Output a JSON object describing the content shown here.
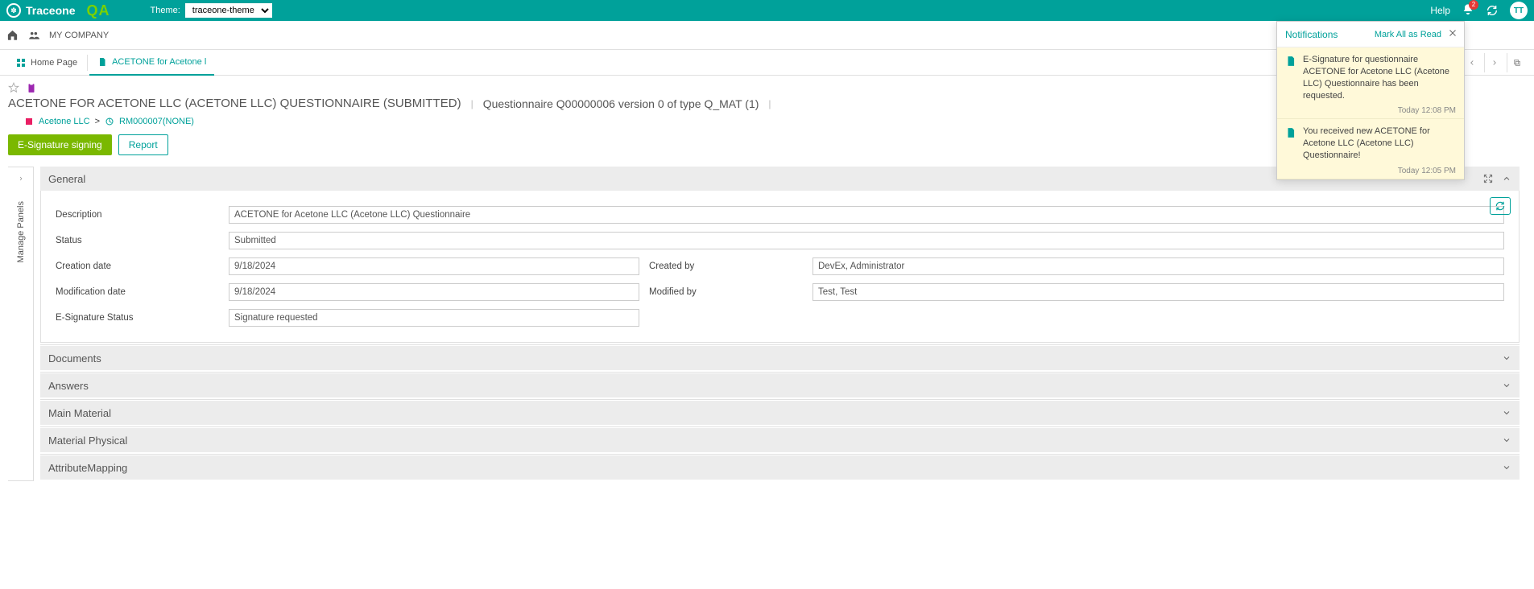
{
  "header": {
    "brand": "Traceone",
    "qa": "QA",
    "theme_label": "Theme:",
    "theme_value": "traceone-theme",
    "help": "Help",
    "bell_count": "2",
    "avatar": "TT"
  },
  "breadcrumb": {
    "company": "MY COMPANY"
  },
  "tabs": {
    "home": "Home Page",
    "current": "ACETONE for Acetone l"
  },
  "title": {
    "main": "ACETONE FOR ACETONE LLC (ACETONE LLC) QUESTIONNAIRE (SUBMITTED)",
    "sub": "Questionnaire Q00000006 version 0 of type Q_MAT (1)"
  },
  "crumb": {
    "org": "Acetone LLC",
    "sep": ">",
    "ref": "RM000007(NONE)"
  },
  "actions": {
    "esign": "E-Signature signing",
    "report": "Report"
  },
  "rail": {
    "label": "Manage Panels"
  },
  "panels": {
    "general": {
      "title": "General",
      "fields": {
        "description_label": "Description",
        "description_value": "ACETONE for Acetone LLC (Acetone LLC) Questionnaire",
        "status_label": "Status",
        "status_value": "Submitted",
        "creation_label": "Creation date",
        "creation_value": "9/18/2024",
        "created_by_label": "Created by",
        "created_by_value": "DevEx, Administrator",
        "mod_label": "Modification date",
        "mod_value": "9/18/2024",
        "mod_by_label": "Modified by",
        "mod_by_value": "Test, Test",
        "esig_label": "E-Signature Status",
        "esig_value": "Signature requested"
      }
    },
    "documents": "Documents",
    "answers": "Answers",
    "main_material": "Main Material",
    "material_physical": "Material Physical",
    "attribute_mapping": "AttributeMapping"
  },
  "notifications": {
    "title": "Notifications",
    "mark_all": "Mark All as Read",
    "items": [
      {
        "text": "E-Signature for questionnaire ACETONE for Acetone LLC (Acetone LLC) Questionnaire has been requested.",
        "time": "Today 12:08 PM"
      },
      {
        "text": "You received new ACETONE for Acetone LLC (Acetone LLC) Questionnaire!",
        "time": "Today 12:05 PM"
      }
    ]
  }
}
